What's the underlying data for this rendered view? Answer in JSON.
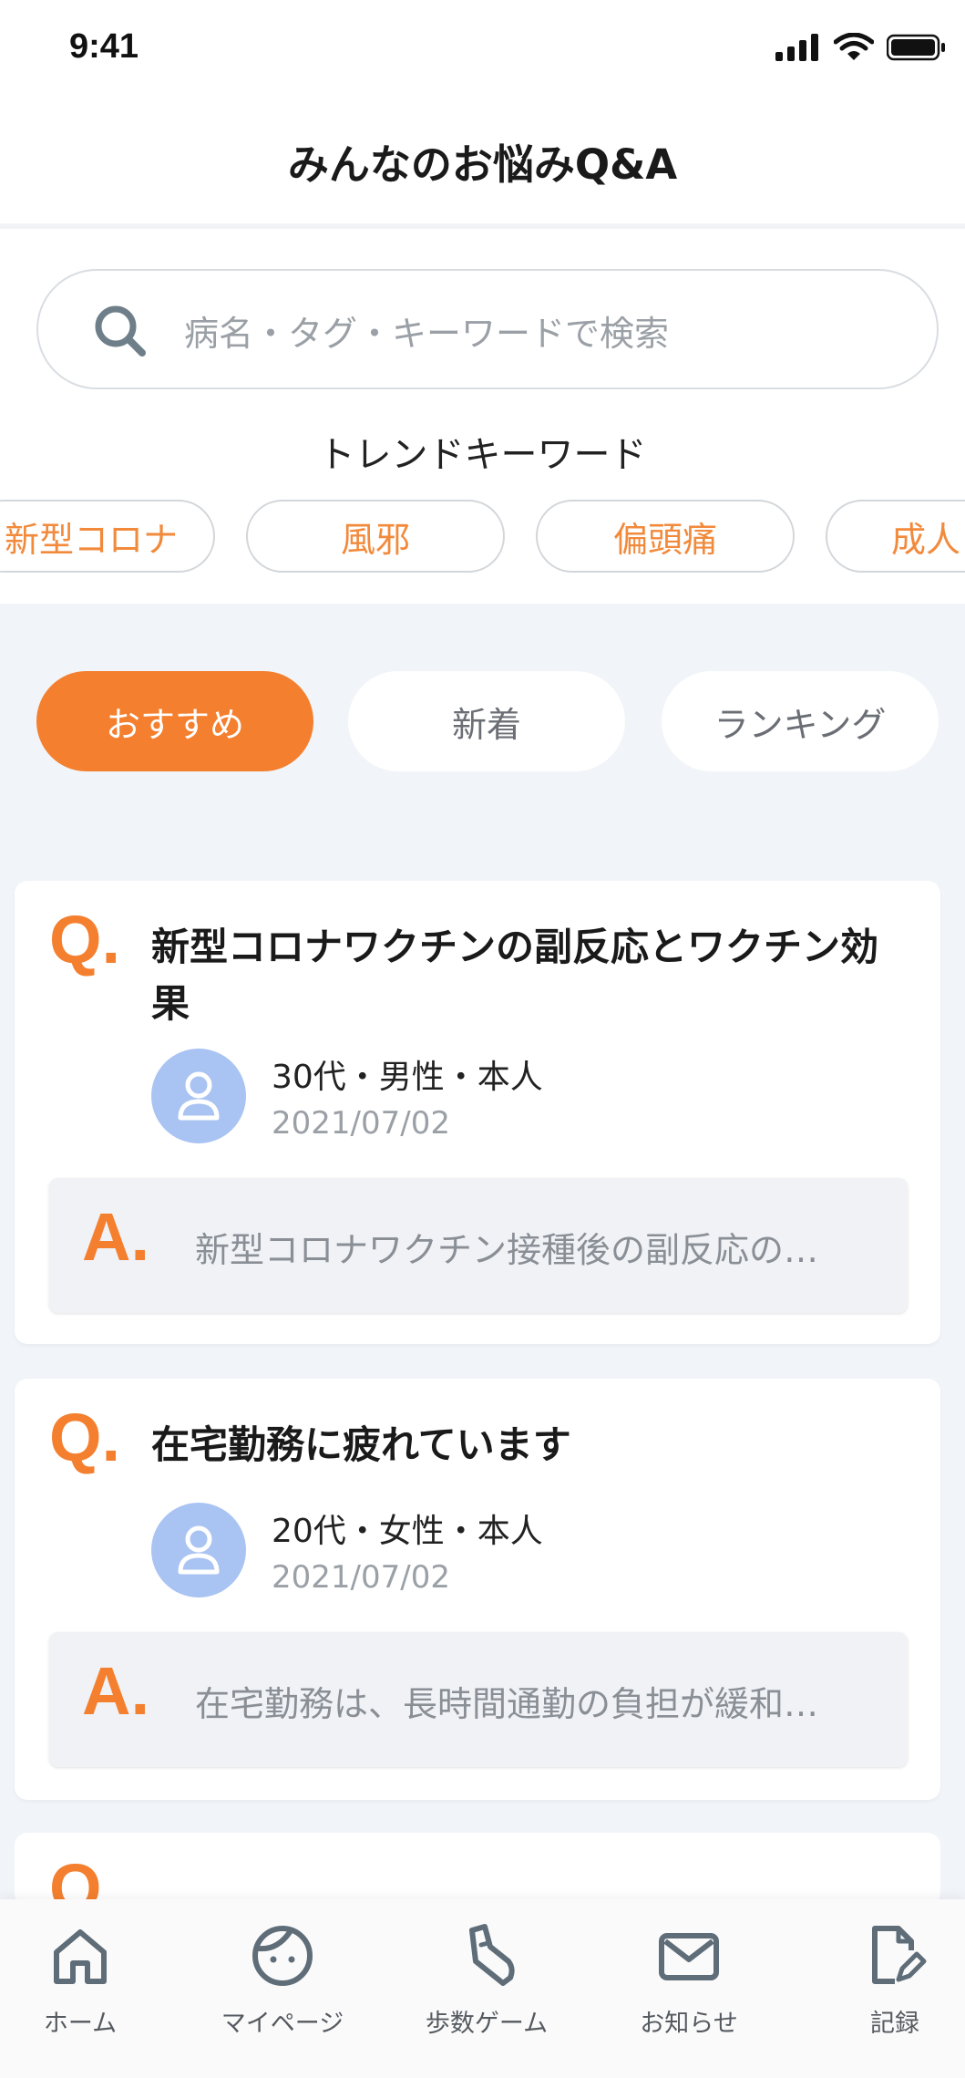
{
  "status_bar": {
    "time": "9:41"
  },
  "header": {
    "title": "みんなのお悩みQ&A"
  },
  "search": {
    "placeholder": "病名・タグ・キーワードで検索"
  },
  "trend": {
    "title": "トレンドキーワード",
    "keywords": [
      "新型コロナ",
      "風邪",
      "偏頭痛",
      "成人"
    ]
  },
  "tabs": [
    {
      "label": "おすすめ",
      "active": true
    },
    {
      "label": "新着",
      "active": false
    },
    {
      "label": "ランキング",
      "active": false
    }
  ],
  "questions": [
    {
      "q_mark": "Q.",
      "question": "新型コロナワクチンの副反応とワクチン効果",
      "profile": "30代・男性・本人",
      "date": "2021/07/02",
      "a_mark": "A.",
      "answer": "新型コロナワクチン接種後の副反応の…"
    },
    {
      "q_mark": "Q.",
      "question": "在宅勤務に疲れています",
      "profile": "20代・女性・本人",
      "date": "2021/07/02",
      "a_mark": "A.",
      "answer": "在宅勤務は、長時間通勤の負担が緩和…"
    }
  ],
  "partial_card": {
    "q_mark": "Q."
  },
  "bottom_nav": [
    {
      "label": "ホーム",
      "icon": "home-icon"
    },
    {
      "label": "マイページ",
      "icon": "face-icon"
    },
    {
      "label": "歩数ゲーム",
      "icon": "shoe-icon"
    },
    {
      "label": "お知らせ",
      "icon": "mail-icon"
    },
    {
      "label": "記録",
      "icon": "record-edit-icon"
    }
  ],
  "colors": {
    "accent": "#f47f2e",
    "chip_text": "#f28a3c",
    "avatar_bg": "#a9c4f2",
    "page_bg": "#f1f4f8"
  }
}
